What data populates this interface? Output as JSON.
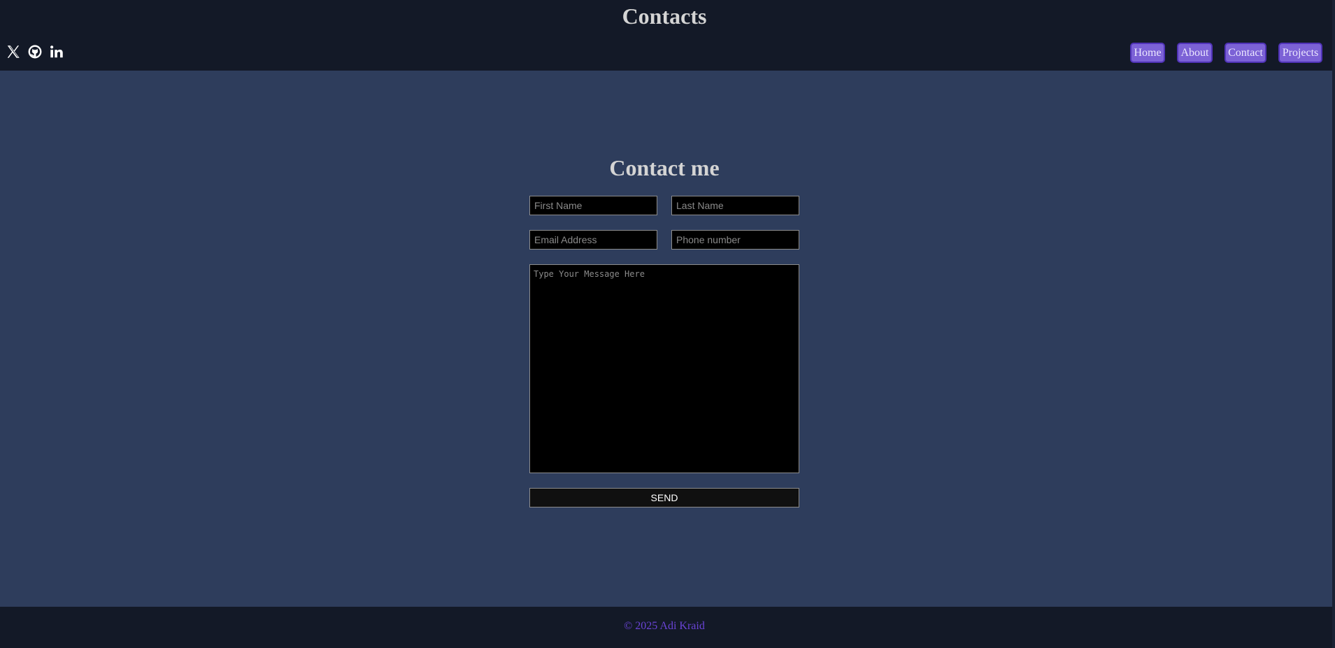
{
  "header": {
    "title": "Contacts",
    "social": [
      {
        "icon": "x-icon"
      },
      {
        "icon": "github-icon"
      },
      {
        "icon": "linkedin-icon"
      }
    ],
    "nav": [
      "Home",
      "About",
      "Contact",
      "Projects"
    ]
  },
  "form": {
    "heading": "Contact me",
    "first_name": {
      "placeholder": "First Name",
      "value": ""
    },
    "last_name": {
      "placeholder": "Last Name",
      "value": ""
    },
    "email": {
      "placeholder": "Email Address",
      "value": ""
    },
    "phone": {
      "placeholder": "Phone number",
      "value": ""
    },
    "message": {
      "placeholder": "Type Your Message Here",
      "value": ""
    },
    "send_label": "SEND"
  },
  "footer": {
    "copyright": "© 2025 Adi Kraid"
  },
  "colors": {
    "page_bg": "#2e3d5c",
    "bar_bg": "#131927",
    "accent": "#7c62d6",
    "footer_text": "#6a44d6"
  }
}
